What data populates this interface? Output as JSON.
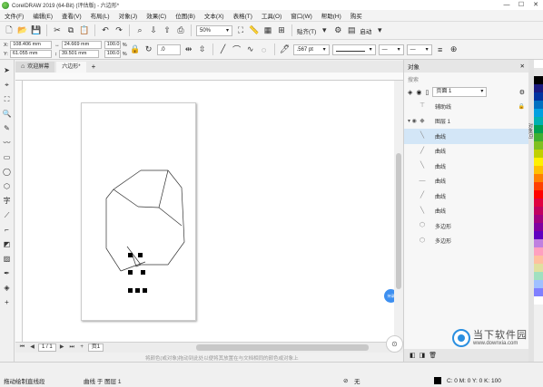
{
  "window": {
    "title": "CorelDRAW 2019 (64-Bit) (评估版) - 六边形*",
    "controls": [
      "—",
      "☐",
      "✕"
    ]
  },
  "menu": [
    "文件(F)",
    "编辑(E)",
    "查看(V)",
    "布局(L)",
    "对象(J)",
    "效果(C)",
    "位图(B)",
    "文本(X)",
    "表格(T)",
    "工具(O)",
    "窗口(W)",
    "帮助(H)",
    "购买"
  ],
  "toolbar1": {
    "zoom": "50%",
    "snap_label": "贴齐(T)",
    "launch_label": "启动"
  },
  "toolbar2": {
    "x": "108.406 mm",
    "y": "61.055 mm",
    "w": "24.669 mm",
    "h": "39.501 mm",
    "scale_w": "100.0",
    "scale_h": "100.0",
    "pct": "%",
    "rotation": ".0",
    "outline_width": ".567 pt"
  },
  "doc_tabs": [
    {
      "label": "欢迎屏幕",
      "active": false
    },
    {
      "label": "六边形*",
      "active": true
    }
  ],
  "blue_badge": "持录",
  "page_nav": {
    "page_info": "1 / 1",
    "page_label": "页1"
  },
  "canvas_hint": "将颜色(或对象)拖动到此处以便将其放置在与文档相同的颜色或对象上",
  "objects_panel": {
    "title": "对象",
    "search_placeholder": "搜索",
    "page_select": "页面 1",
    "rows": [
      {
        "lead": "",
        "icon": "guides-icon",
        "label": "辅助线",
        "selected": false,
        "lock": "🔒"
      },
      {
        "lead": "▾ ◉",
        "icon": "layer-icon",
        "label": "图层 1",
        "selected": false,
        "lock": ""
      },
      {
        "lead": "",
        "icon": "curve-icon",
        "label": "曲线",
        "selected": true,
        "lock": ""
      },
      {
        "lead": "",
        "icon": "curve-icon",
        "label": "曲线",
        "selected": false,
        "lock": ""
      },
      {
        "lead": "",
        "icon": "curve-icon",
        "label": "曲线",
        "selected": false,
        "lock": ""
      },
      {
        "lead": "",
        "icon": "curve-icon",
        "label": "曲线",
        "selected": false,
        "lock": ""
      },
      {
        "lead": "",
        "icon": "curve-icon",
        "label": "曲线",
        "selected": false,
        "lock": ""
      },
      {
        "lead": "",
        "icon": "curve-icon",
        "label": "曲线",
        "selected": false,
        "lock": ""
      },
      {
        "lead": "",
        "icon": "polygon-icon",
        "label": "多边形",
        "selected": false,
        "lock": ""
      },
      {
        "lead": "",
        "icon": "polygon-icon",
        "label": "多边形",
        "selected": false,
        "lock": ""
      }
    ]
  },
  "side_tab": "对象(O)",
  "palette": [
    "#ffffff",
    "#e6e6e6",
    "#000000",
    "#1a1a80",
    "#0033a0",
    "#0070c0",
    "#00a0e0",
    "#00b0b0",
    "#00a050",
    "#40b030",
    "#80c020",
    "#c0d000",
    "#fff000",
    "#ffc000",
    "#ff8000",
    "#ff4000",
    "#ff0000",
    "#e00040",
    "#c00060",
    "#a00080",
    "#8000a0",
    "#6000c0",
    "#c080e0",
    "#ffa0c0",
    "#ffc0a0",
    "#e0e0a0",
    "#a0e0c0",
    "#a0c0ff",
    "#8080ff",
    "#ffffff"
  ],
  "status": {
    "left_hint": "拖动绘制直线段",
    "object_info": "曲线 于 图层 1",
    "fill_none": "无",
    "cmyk": "C: 0 M: 0 Y: 0 K: 100"
  },
  "watermark": {
    "cn": "当下软件园",
    "en": "www.downxia.com"
  }
}
